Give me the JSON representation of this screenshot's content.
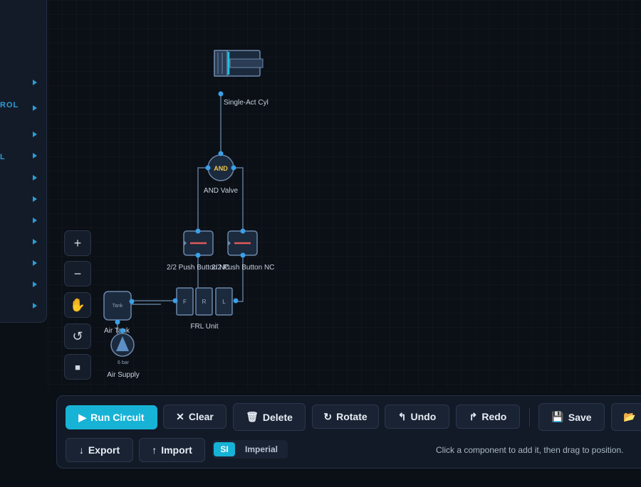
{
  "sidebar": {
    "labels": [
      "ROL",
      "L"
    ],
    "arrow_count": 11
  },
  "zoom_controls": {
    "zoom_in": "+",
    "zoom_out": "−",
    "pan": "✋",
    "reset": "↺",
    "fit": "■"
  },
  "circuit": {
    "components": {
      "cylinder": "Single-Act Cyl",
      "and_valve_symbol": "AND",
      "and_valve": "AND Valve",
      "push_nc_left": "2/2 Push Button NC",
      "push_nc_right": "2/2 Push Button NC",
      "tank_symbol": "Tank",
      "tank": "Air Tank",
      "frl_f": "F",
      "frl_r": "R",
      "frl_l": "L",
      "frl": "FRL Unit",
      "supply_pressure": "6 bar",
      "supply": "Air Supply"
    }
  },
  "toolbar": {
    "run": "Run Circuit",
    "clear": "Clear",
    "delete": "Delete",
    "rotate": "Rotate",
    "undo": "Undo",
    "redo": "Redo",
    "save": "Save",
    "export": "Export",
    "import": "Import",
    "units": {
      "si": "SI",
      "imperial": "Imperial",
      "selected": "SI"
    },
    "hint": "Click a component to add it, then drag to position."
  },
  "colors": {
    "accent": "#17b3d6",
    "connector": "#3aa0e8",
    "and_text": "#f2c84b",
    "button_indicator": "#e05a5a"
  }
}
